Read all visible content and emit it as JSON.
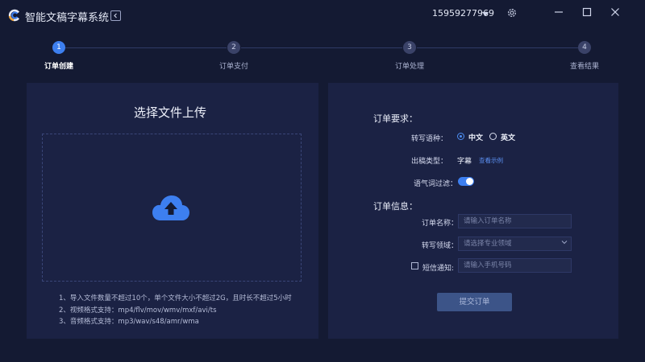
{
  "app": {
    "title": "智能文稿字幕系统",
    "phone": "15959277969"
  },
  "steps": [
    {
      "num": "1",
      "label": "订单创建",
      "active": true
    },
    {
      "num": "2",
      "label": "订单支付",
      "active": false
    },
    {
      "num": "3",
      "label": "订单处理",
      "active": false
    },
    {
      "num": "4",
      "label": "查看结果",
      "active": false
    }
  ],
  "upload": {
    "title": "选择文件上传",
    "notes": [
      "1、导入文件数量不超过10个，单个文件大小不超过2G，且时长不超过5小时",
      "2、视频格式支持：mp4/flv/mov/wmv/mxf/avi/ts",
      "3、音频格式支持：mp3/wav/s48/amr/wma"
    ]
  },
  "order_requirements": {
    "title": "订单要求：",
    "language_label": "转写语种：",
    "lang_zh": "中文",
    "lang_en": "英文",
    "output_label": "出稿类型：",
    "output_value": "字幕",
    "example_link": "查看示例",
    "filter_label": "语气词过滤："
  },
  "order_info": {
    "title": "订单信息：",
    "name_label": "订单名称：",
    "name_placeholder": "请输入订单名称",
    "domain_label": "转写领域：",
    "domain_placeholder": "请选择专业领域",
    "sms_label": "短信通知:",
    "sms_placeholder": "请输入手机号码",
    "submit_label": "提交订单"
  },
  "colors": {
    "accent": "#3d7ff0",
    "background": "#141a33",
    "panel": "#1b2244"
  }
}
